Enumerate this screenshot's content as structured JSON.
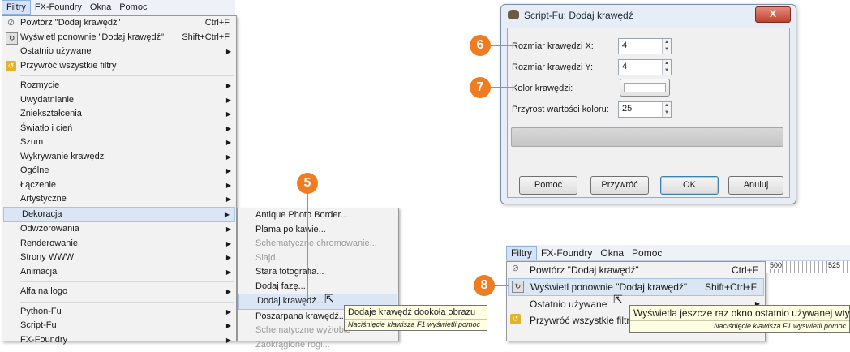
{
  "left": {
    "menubar": [
      "Filtry",
      "FX-Foundry",
      "Okna",
      "Pomoc"
    ],
    "menu": {
      "items": [
        {
          "label": "Powtórz \"Dodaj krawędź\"",
          "accel": "Ctrl+F",
          "icon": "repeat-icon"
        },
        {
          "label": "Wyświetl ponownie \"Dodaj krawędź\"",
          "accel": "Shift+Ctrl+F",
          "icon": "reshow-icon"
        },
        {
          "label": "Ostatnio używane",
          "submenu": true
        },
        {
          "label": "Przywróć wszystkie filtry",
          "icon": "reset-filters-icon"
        },
        {
          "sep": true
        },
        {
          "label": "Rozmycie",
          "submenu": true
        },
        {
          "label": "Uwydatnianie",
          "submenu": true
        },
        {
          "label": "Zniekształcenia",
          "submenu": true
        },
        {
          "label": "Światło i cień",
          "submenu": true
        },
        {
          "label": "Szum",
          "submenu": true
        },
        {
          "label": "Wykrywanie krawędzi",
          "submenu": true
        },
        {
          "label": "Ogólne",
          "submenu": true
        },
        {
          "label": "Łączenie",
          "submenu": true
        },
        {
          "label": "Artystyczne",
          "submenu": true
        },
        {
          "label": "Dekoracja",
          "submenu": true,
          "highlight": true
        },
        {
          "label": "Odwzorowania",
          "submenu": true
        },
        {
          "label": "Renderowanie",
          "submenu": true
        },
        {
          "label": "Strony WWW",
          "submenu": true
        },
        {
          "label": "Animacja",
          "submenu": true
        },
        {
          "sep": true
        },
        {
          "label": "Alfa na logo",
          "submenu": true
        },
        {
          "sep": true
        },
        {
          "label": "Python-Fu",
          "submenu": true
        },
        {
          "label": "Script-Fu",
          "submenu": true
        },
        {
          "label": "FX-Foundry",
          "submenu": true
        }
      ]
    },
    "submenu": {
      "items": [
        {
          "label": "Antique Photo Border..."
        },
        {
          "label": "Plama po kawie..."
        },
        {
          "label": "Schematyczne chromowanie...",
          "disabled": true
        },
        {
          "label": "Slajd...",
          "disabled": true
        },
        {
          "label": "Stara fotografia..."
        },
        {
          "label": "Dodaj fazę..."
        },
        {
          "label": "Dodaj krawędź...",
          "highlight": true
        },
        {
          "label": "Poszarpana krawędź..."
        },
        {
          "label": "Schematyczne wyżłobie",
          "disabled": true
        },
        {
          "label": "Zaokrąglone rogi...",
          "disabled": true
        }
      ]
    },
    "tooltip": {
      "text": "Dodaje krawędź dookoła obrazu",
      "hint": "Naciśnięcie klawisza F1 wyświetli pomoc"
    },
    "badge": "5"
  },
  "dialog": {
    "title": "Script-Fu: Dodaj krawędź",
    "close": "X",
    "fields": {
      "size_x_label": "Rozmiar krawędzi X:",
      "size_x_value": "4",
      "size_y_label": "Rozmiar krawędzi Y:",
      "size_y_value": "4",
      "color_label": "Kolor krawędzi:",
      "delta_label": "Przyrost wartości koloru:",
      "delta_value": "25"
    },
    "buttons": {
      "help": "Pomoc",
      "reset": "Przywróć",
      "ok": "OK",
      "cancel": "Anuluj"
    },
    "badges": [
      "6",
      "7"
    ]
  },
  "bottom_right": {
    "menubar": [
      "Filtry",
      "FX-Foundry",
      "Okna",
      "Pomoc"
    ],
    "items": [
      {
        "label": "Powtórz \"Dodaj krawędź\"",
        "accel": "Ctrl+F"
      },
      {
        "label": "Wyświetl ponownie \"Dodaj krawędź\"",
        "accel": "Shift+Ctrl+F"
      },
      {
        "label": "Ostatnio używane"
      },
      {
        "label": "Przywróć wszystkie filtry"
      }
    ],
    "ruler": [
      "500",
      "525"
    ],
    "tooltip": {
      "text": "Wyświetla jeszcze raz okno ostatnio używanej wtyczki",
      "hint": "Naciśnięcie klawisza F1 wyświetli pomoc"
    },
    "badge": "8"
  },
  "colors": {
    "accent": "#f07c22",
    "highlight": "#dbe6f5"
  }
}
